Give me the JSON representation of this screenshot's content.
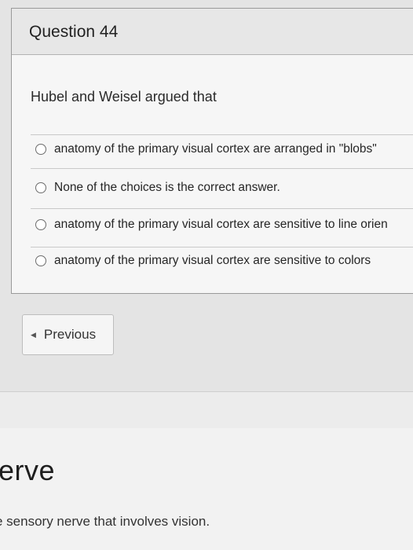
{
  "question": {
    "title": "Question 44",
    "prompt": "Hubel and Weisel argued that",
    "options": [
      "anatomy of the primary visual cortex are arranged in \"blobs\"",
      "None of the choices is the correct answer.",
      "anatomy of the primary visual cortex are sensitive to line orien",
      "anatomy of the primary visual cortex are sensitive to colors"
    ]
  },
  "nav": {
    "previous_label": "Previous",
    "previous_icon": "chevron-left-icon"
  },
  "background_page": {
    "heading": "erve",
    "text": "e sensory nerve that involves vision."
  }
}
